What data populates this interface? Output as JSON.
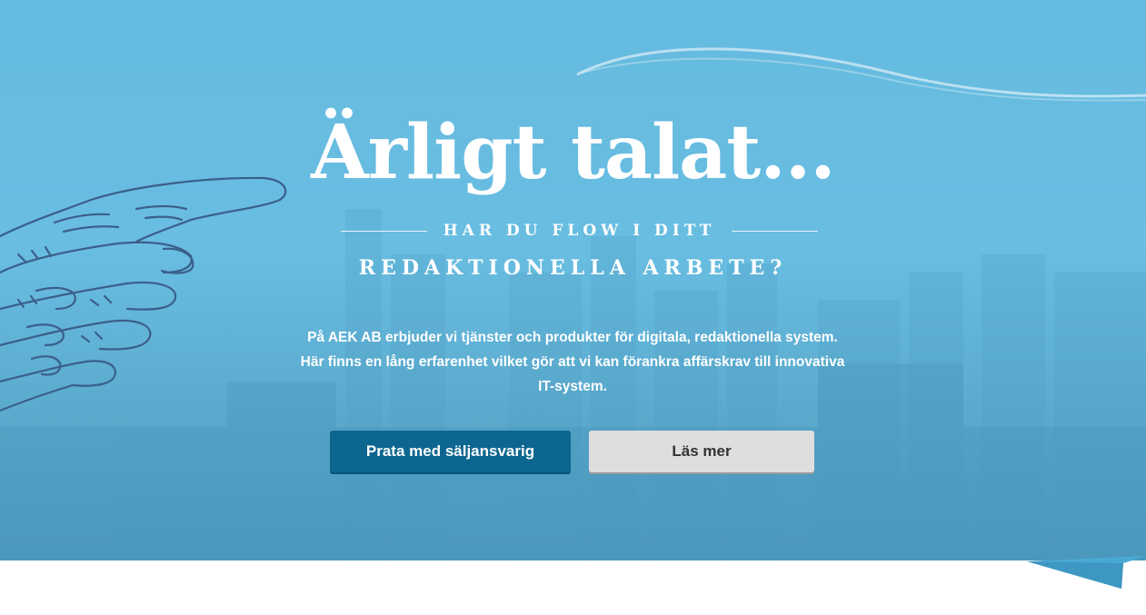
{
  "hero": {
    "headline": "Ärligt talat...",
    "subheading_line1": "HAR DU FLOW I DITT",
    "subheading_line2": "REDAKTIONELLA ARBETE?",
    "body": "På AEK AB erbjuder vi tjänster och produkter för digitala, redaktionella system. Här finns en lång erfarenhet vilket gör att vi kan förankra affärskrav till innovativa IT-system.",
    "background_color": "#66bbe0"
  },
  "actions": {
    "primary_label": "Prata med säljansvarig",
    "secondary_label": "Läs mer",
    "primary_color": "#0d6690",
    "secondary_color": "#dedede"
  },
  "icons": {
    "hand": "pointing-hand-illustration",
    "wave": "decorative-wave",
    "ribbon": "ribbon-corner"
  }
}
